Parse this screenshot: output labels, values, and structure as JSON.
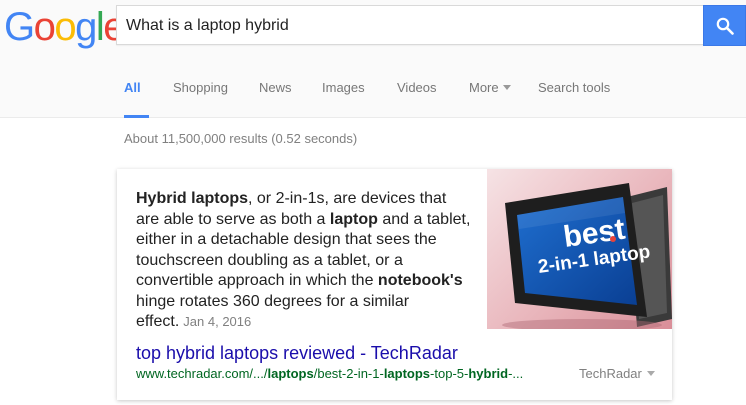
{
  "logo": {
    "letters": [
      "G",
      "o",
      "o",
      "g",
      "l",
      "e"
    ]
  },
  "search": {
    "query": "What is a laptop hybrid"
  },
  "tabs": [
    {
      "label": "All"
    },
    {
      "label": "Shopping"
    },
    {
      "label": "News"
    },
    {
      "label": "Images"
    },
    {
      "label": "Videos"
    },
    {
      "label": "More"
    },
    {
      "label": "Search tools"
    }
  ],
  "result_stats": "About 11,500,000 results (0.52 seconds)",
  "snippet": {
    "parts": [
      {
        "text": "Hybrid laptops",
        "bold": true
      },
      {
        "text": ", or 2-in-1s, are devices that are able to serve as both a ",
        "bold": false
      },
      {
        "text": "laptop",
        "bold": true
      },
      {
        "text": " and a tablet, either in a detachable design that sees the touchscreen doubling as a tablet, or a convertible approach in which the ",
        "bold": false
      },
      {
        "text": "notebook's",
        "bold": true
      },
      {
        "text": " hinge rotates 360 degrees for a similar effect.",
        "bold": false
      }
    ],
    "date": "Jan 4, 2016",
    "image_text": {
      "line1": "best",
      "line2": "2-in-1 laptop"
    }
  },
  "result": {
    "title": "top hybrid laptops reviewed - TechRadar",
    "url_parts": [
      {
        "text": "www.techradar.com/.../",
        "bold": false
      },
      {
        "text": "laptops",
        "bold": true
      },
      {
        "text": "/best-2-in-1-",
        "bold": false
      },
      {
        "text": "laptops",
        "bold": true
      },
      {
        "text": "-top-5-",
        "bold": false
      },
      {
        "text": "hybrid",
        "bold": true
      },
      {
        "text": "-...",
        "bold": false
      }
    ],
    "source": "TechRadar"
  },
  "colors": {
    "accent": "#4285f4",
    "link": "#1a0dab",
    "url": "#006621",
    "muted": "#808080"
  }
}
